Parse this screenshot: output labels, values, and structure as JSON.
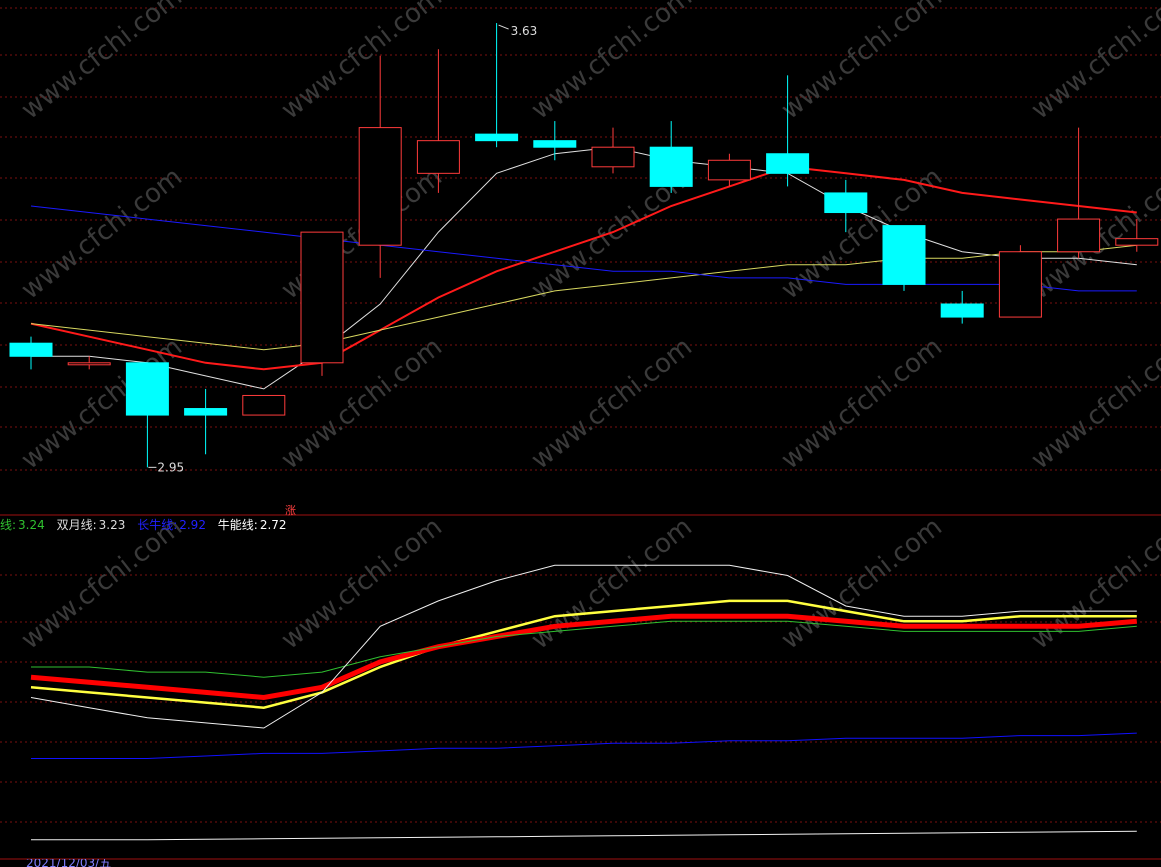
{
  "colors": {
    "background": "#000000",
    "up": "#ff3b3b",
    "down": "#00ffff",
    "grid": "#7a1010",
    "ma_white": "#e0e0e0",
    "ma_red": "#ff1a1a",
    "ma_yellow": "#d8d860",
    "ma_blue": "#1a1aff",
    "ind_white": "#f0f0f0",
    "ind_yellow": "#ffff40",
    "ind_red": "#ff0000",
    "ind_green": "#30c030",
    "ind_blue": "#1010ff"
  },
  "annotations": {
    "high_label": "3.63",
    "low_label": "2.95",
    "rise_flag": "涨"
  },
  "legend": {
    "item1_name": "线:",
    "item1_value": "3.24",
    "item2_name": "双月线:",
    "item2_value": "3.23",
    "item3_name": "长牛线:",
    "item3_value": "2.92",
    "item4_name": "牛能线:",
    "item4_value": "2.72"
  },
  "date_label": "2021/12/03/五",
  "watermark": "www.cfchi.com",
  "chart_data": [
    {
      "type": "candlestick",
      "ylim": [
        2.9,
        3.65
      ],
      "candles": [
        {
          "open": 3.14,
          "close": 3.12,
          "high": 3.15,
          "low": 3.1
        },
        {
          "open": 3.11,
          "close": 3.11,
          "high": 3.12,
          "low": 3.1
        },
        {
          "open": 3.11,
          "close": 3.03,
          "high": 3.11,
          "low": 2.95
        },
        {
          "open": 3.04,
          "close": 3.03,
          "high": 3.07,
          "low": 2.97
        },
        {
          "open": 3.03,
          "close": 3.06,
          "high": 3.06,
          "low": 3.03
        },
        {
          "open": 3.11,
          "close": 3.31,
          "high": 3.31,
          "low": 3.09
        },
        {
          "open": 3.29,
          "close": 3.47,
          "high": 3.58,
          "low": 3.24
        },
        {
          "open": 3.4,
          "close": 3.45,
          "high": 3.59,
          "low": 3.37
        },
        {
          "open": 3.46,
          "close": 3.45,
          "high": 3.63,
          "low": 3.44
        },
        {
          "open": 3.45,
          "close": 3.44,
          "high": 3.48,
          "low": 3.42
        },
        {
          "open": 3.41,
          "close": 3.44,
          "high": 3.47,
          "low": 3.4
        },
        {
          "open": 3.44,
          "close": 3.38,
          "high": 3.48,
          "low": 3.37
        },
        {
          "open": 3.39,
          "close": 3.42,
          "high": 3.43,
          "low": 3.38
        },
        {
          "open": 3.43,
          "close": 3.4,
          "high": 3.55,
          "low": 3.38
        },
        {
          "open": 3.37,
          "close": 3.34,
          "high": 3.39,
          "low": 3.31
        },
        {
          "open": 3.32,
          "close": 3.23,
          "high": 3.32,
          "low": 3.22
        },
        {
          "open": 3.2,
          "close": 3.18,
          "high": 3.22,
          "low": 3.17
        },
        {
          "open": 3.18,
          "close": 3.28,
          "high": 3.29,
          "low": 3.18
        },
        {
          "open": 3.28,
          "close": 3.33,
          "high": 3.47,
          "low": 3.27
        },
        {
          "open": 3.29,
          "close": 3.3,
          "high": 3.33,
          "low": 3.28
        }
      ],
      "ma": [
        {
          "color_key": "ma_white",
          "values": [
            3.12,
            3.12,
            3.11,
            3.09,
            3.07,
            3.13,
            3.2,
            3.31,
            3.4,
            3.43,
            3.44,
            3.42,
            3.41,
            3.4,
            3.35,
            3.31,
            3.28,
            3.27,
            3.27,
            3.26
          ]
        },
        {
          "color_key": "ma_red",
          "values": [
            3.17,
            3.15,
            3.13,
            3.11,
            3.1,
            3.11,
            3.16,
            3.21,
            3.25,
            3.28,
            3.31,
            3.35,
            3.38,
            3.41,
            3.4,
            3.39,
            3.37,
            3.36,
            3.35,
            3.34
          ]
        },
        {
          "color_key": "ma_yellow",
          "values": [
            3.17,
            3.16,
            3.15,
            3.14,
            3.13,
            3.14,
            3.16,
            3.18,
            3.2,
            3.22,
            3.23,
            3.24,
            3.25,
            3.26,
            3.26,
            3.27,
            3.27,
            3.28,
            3.28,
            3.29
          ]
        },
        {
          "color_key": "ma_blue",
          "values": [
            3.35,
            3.34,
            3.33,
            3.32,
            3.31,
            3.3,
            3.29,
            3.28,
            3.27,
            3.26,
            3.25,
            3.25,
            3.24,
            3.24,
            3.23,
            3.23,
            3.23,
            3.23,
            3.22,
            3.22
          ]
        }
      ]
    },
    {
      "type": "line",
      "series": [
        {
          "name": "双月线",
          "color_key": "ind_yellow",
          "values": [
            3.02,
            3.01,
            3.0,
            2.99,
            2.98,
            3.01,
            3.06,
            3.1,
            3.13,
            3.16,
            3.17,
            3.18,
            3.19,
            3.19,
            3.17,
            3.15,
            3.15,
            3.16,
            3.16,
            3.16
          ]
        },
        {
          "color_key": "ind_red",
          "values": [
            3.04,
            3.03,
            3.02,
            3.01,
            3.0,
            3.02,
            3.07,
            3.1,
            3.12,
            3.14,
            3.15,
            3.16,
            3.16,
            3.16,
            3.15,
            3.14,
            3.14,
            3.14,
            3.14,
            3.15
          ]
        },
        {
          "color_key": "ind_green",
          "values": [
            3.06,
            3.06,
            3.05,
            3.05,
            3.04,
            3.05,
            3.08,
            3.1,
            3.12,
            3.13,
            3.14,
            3.15,
            3.15,
            3.15,
            3.14,
            3.13,
            3.13,
            3.13,
            3.13,
            3.14
          ]
        },
        {
          "color_key": "ind_white",
          "values": [
            3.0,
            2.98,
            2.96,
            2.95,
            2.94,
            3.01,
            3.14,
            3.19,
            3.23,
            3.26,
            3.26,
            3.26,
            3.26,
            3.24,
            3.18,
            3.16,
            3.16,
            3.17,
            3.17,
            3.17
          ]
        },
        {
          "name": "长牛线",
          "color_key": "ind_blue",
          "values": [
            2.88,
            2.88,
            2.88,
            2.885,
            2.89,
            2.89,
            2.895,
            2.9,
            2.9,
            2.905,
            2.91,
            2.91,
            2.915,
            2.915,
            2.92,
            2.92,
            2.92,
            2.925,
            2.925,
            2.93
          ]
        },
        {
          "name": "牛能线",
          "color_key": "ind_white",
          "values": [
            2.72,
            2.72,
            2.72,
            2.721,
            2.722,
            2.723,
            2.724,
            2.725,
            2.726,
            2.727,
            2.728,
            2.729,
            2.73,
            2.731,
            2.732,
            2.733,
            2.734,
            2.735,
            2.736,
            2.737
          ]
        }
      ],
      "ylim": [
        2.7,
        3.3
      ]
    }
  ]
}
